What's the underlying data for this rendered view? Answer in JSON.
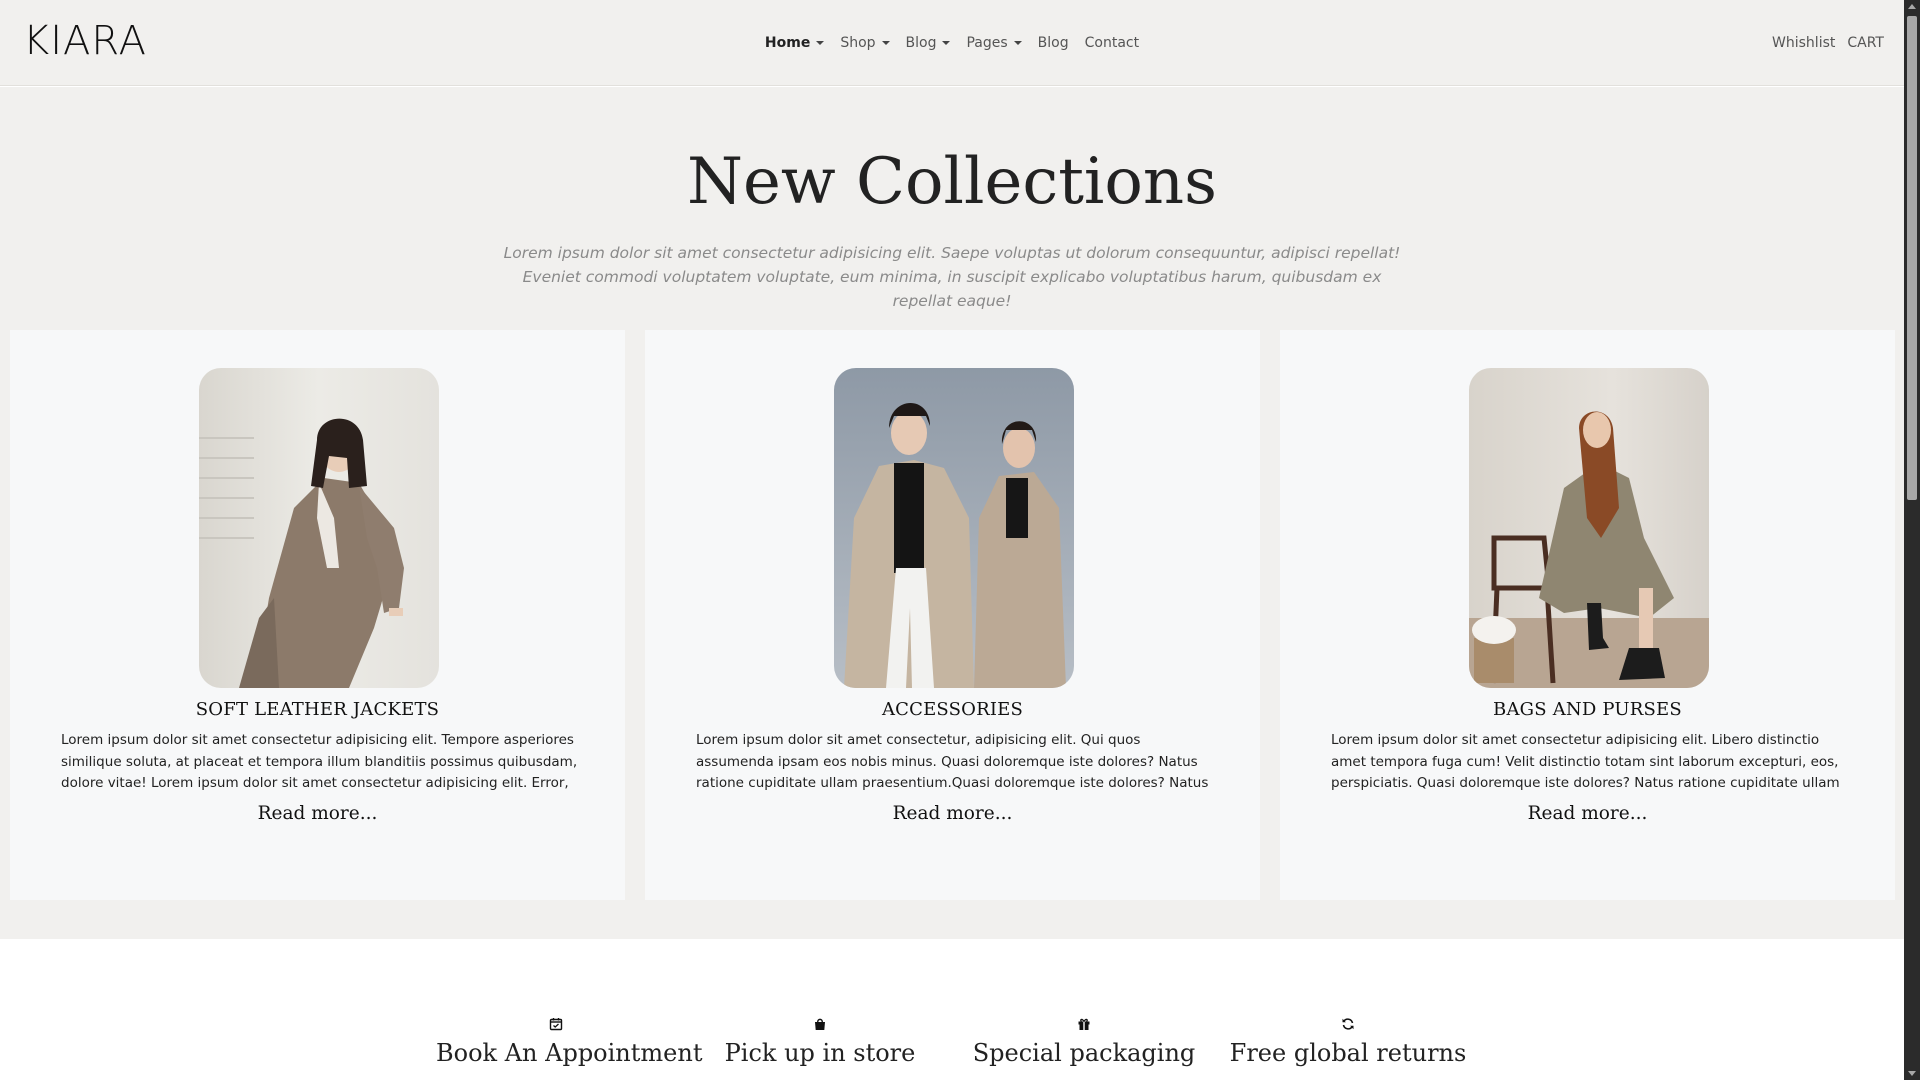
{
  "brand": "KIARA",
  "nav": {
    "items": [
      {
        "label": "Home",
        "dropdown": true,
        "active": true
      },
      {
        "label": "Shop",
        "dropdown": true
      },
      {
        "label": "Blog",
        "dropdown": true
      },
      {
        "label": "Pages",
        "dropdown": true
      },
      {
        "label": "Blog",
        "dropdown": false
      },
      {
        "label": "Contact",
        "dropdown": false
      }
    ],
    "right": [
      "Whishlist",
      "CART"
    ]
  },
  "hero": {
    "title": "New Collections",
    "subtitle": "Lorem ipsum dolor sit amet consectetur adipisicing elit. Saepe voluptas ut dolorum consequuntur, adipisci repellat! Eveniet commodi voluptatem voluptate, eum minima, in suscipit explicabo voluptatibus harum, quibusdam ex repellat eaque!"
  },
  "cards": [
    {
      "title": "SOFT LEATHER JACKETS",
      "text": "Lorem ipsum dolor sit amet consectetur adipisicing elit. Tempore asperiores similique soluta, at placeat et tempora illum blanditiis possimus quibusdam, dolore vitae! Lorem ipsum dolor sit amet consectetur adipisicing elit. Error, fuga optio ad...",
      "read_more": "Read more..."
    },
    {
      "title": "ACCESSORIES",
      "text": "Lorem ipsum dolor sit amet consectetur, adipisicing elit. Qui quos assumenda ipsam eos nobis minus. Quasi doloremque iste dolores? Natus ratione cupiditate ullam praesentium.Quasi doloremque iste dolores? Natus ratione cupiditate ullam...",
      "read_more": "Read more..."
    },
    {
      "title": "BAGS AND PURSES",
      "text": "Lorem ipsum dolor sit amet consectetur adipisicing elit. Libero distinctio amet tempora fuga cum! Velit distinctio totam sint laborum excepturi, eos, perspiciatis. Quasi doloremque iste dolores? Natus ratione cupiditate ullam praesentium.Quasi...",
      "read_more": "Read more..."
    }
  ],
  "features": [
    {
      "icon": "calendar-check-icon",
      "label": "Book An Appointment"
    },
    {
      "icon": "shopping-bag-icon",
      "label": "Pick up in store"
    },
    {
      "icon": "gift-icon",
      "label": "Special packaging"
    },
    {
      "icon": "refresh-icon",
      "label": "Free global returns"
    }
  ],
  "colors": {
    "background": "#f1f0ee",
    "card": "#f7f8f9",
    "text": "#212529",
    "muted": "#8a8a8a"
  }
}
